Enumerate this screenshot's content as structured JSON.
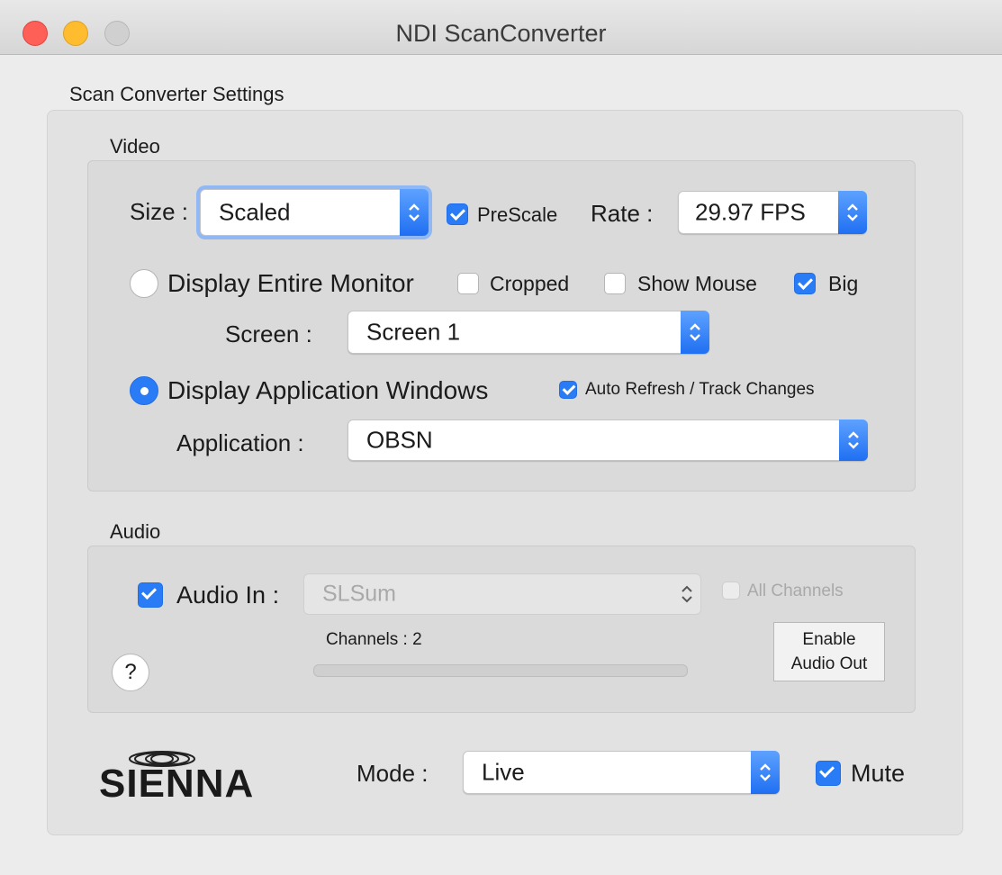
{
  "window": {
    "title": "NDI ScanConverter"
  },
  "settings": {
    "title": "Scan Converter Settings"
  },
  "video": {
    "title": "Video",
    "size_label": "Size :",
    "size_value": "Scaled",
    "prescale_label": "PreScale",
    "prescale_checked": true,
    "rate_label": "Rate :",
    "rate_value": "29.97 FPS",
    "display_entire_monitor_label": "Display Entire Monitor",
    "display_entire_monitor_selected": false,
    "cropped_label": "Cropped",
    "cropped_checked": false,
    "show_mouse_label": "Show Mouse",
    "show_mouse_checked": false,
    "big_label": "Big",
    "big_checked": true,
    "screen_label": "Screen :",
    "screen_value": "Screen 1",
    "display_app_windows_label": "Display Application Windows",
    "display_app_windows_selected": true,
    "auto_refresh_label": "Auto Refresh / Track Changes",
    "auto_refresh_checked": true,
    "application_label": "Application :",
    "application_value": "OBSN"
  },
  "audio": {
    "title": "Audio",
    "audio_in_label": "Audio In :",
    "audio_in_checked": true,
    "audio_in_value": "SLSum",
    "all_channels_label": "All Channels",
    "all_channels_checked": false,
    "channels_text": "Channels : 2",
    "level": 0,
    "help_label": "?",
    "enable_audio_out_line1": "Enable",
    "enable_audio_out_line2": "Audio Out"
  },
  "footer": {
    "logo_text": "SIENNA",
    "mode_label": "Mode :",
    "mode_value": "Live",
    "mute_label": "Mute",
    "mute_checked": true
  },
  "colors": {
    "accent": "#2a7cf6",
    "close": "#fe5f57",
    "minimize": "#febc2e",
    "zoom": "#d0d0d0"
  },
  "icons": [
    "close-button",
    "minimize-button",
    "zoom-button",
    "stepper-icon",
    "help-icon",
    "sienna-logo"
  ]
}
